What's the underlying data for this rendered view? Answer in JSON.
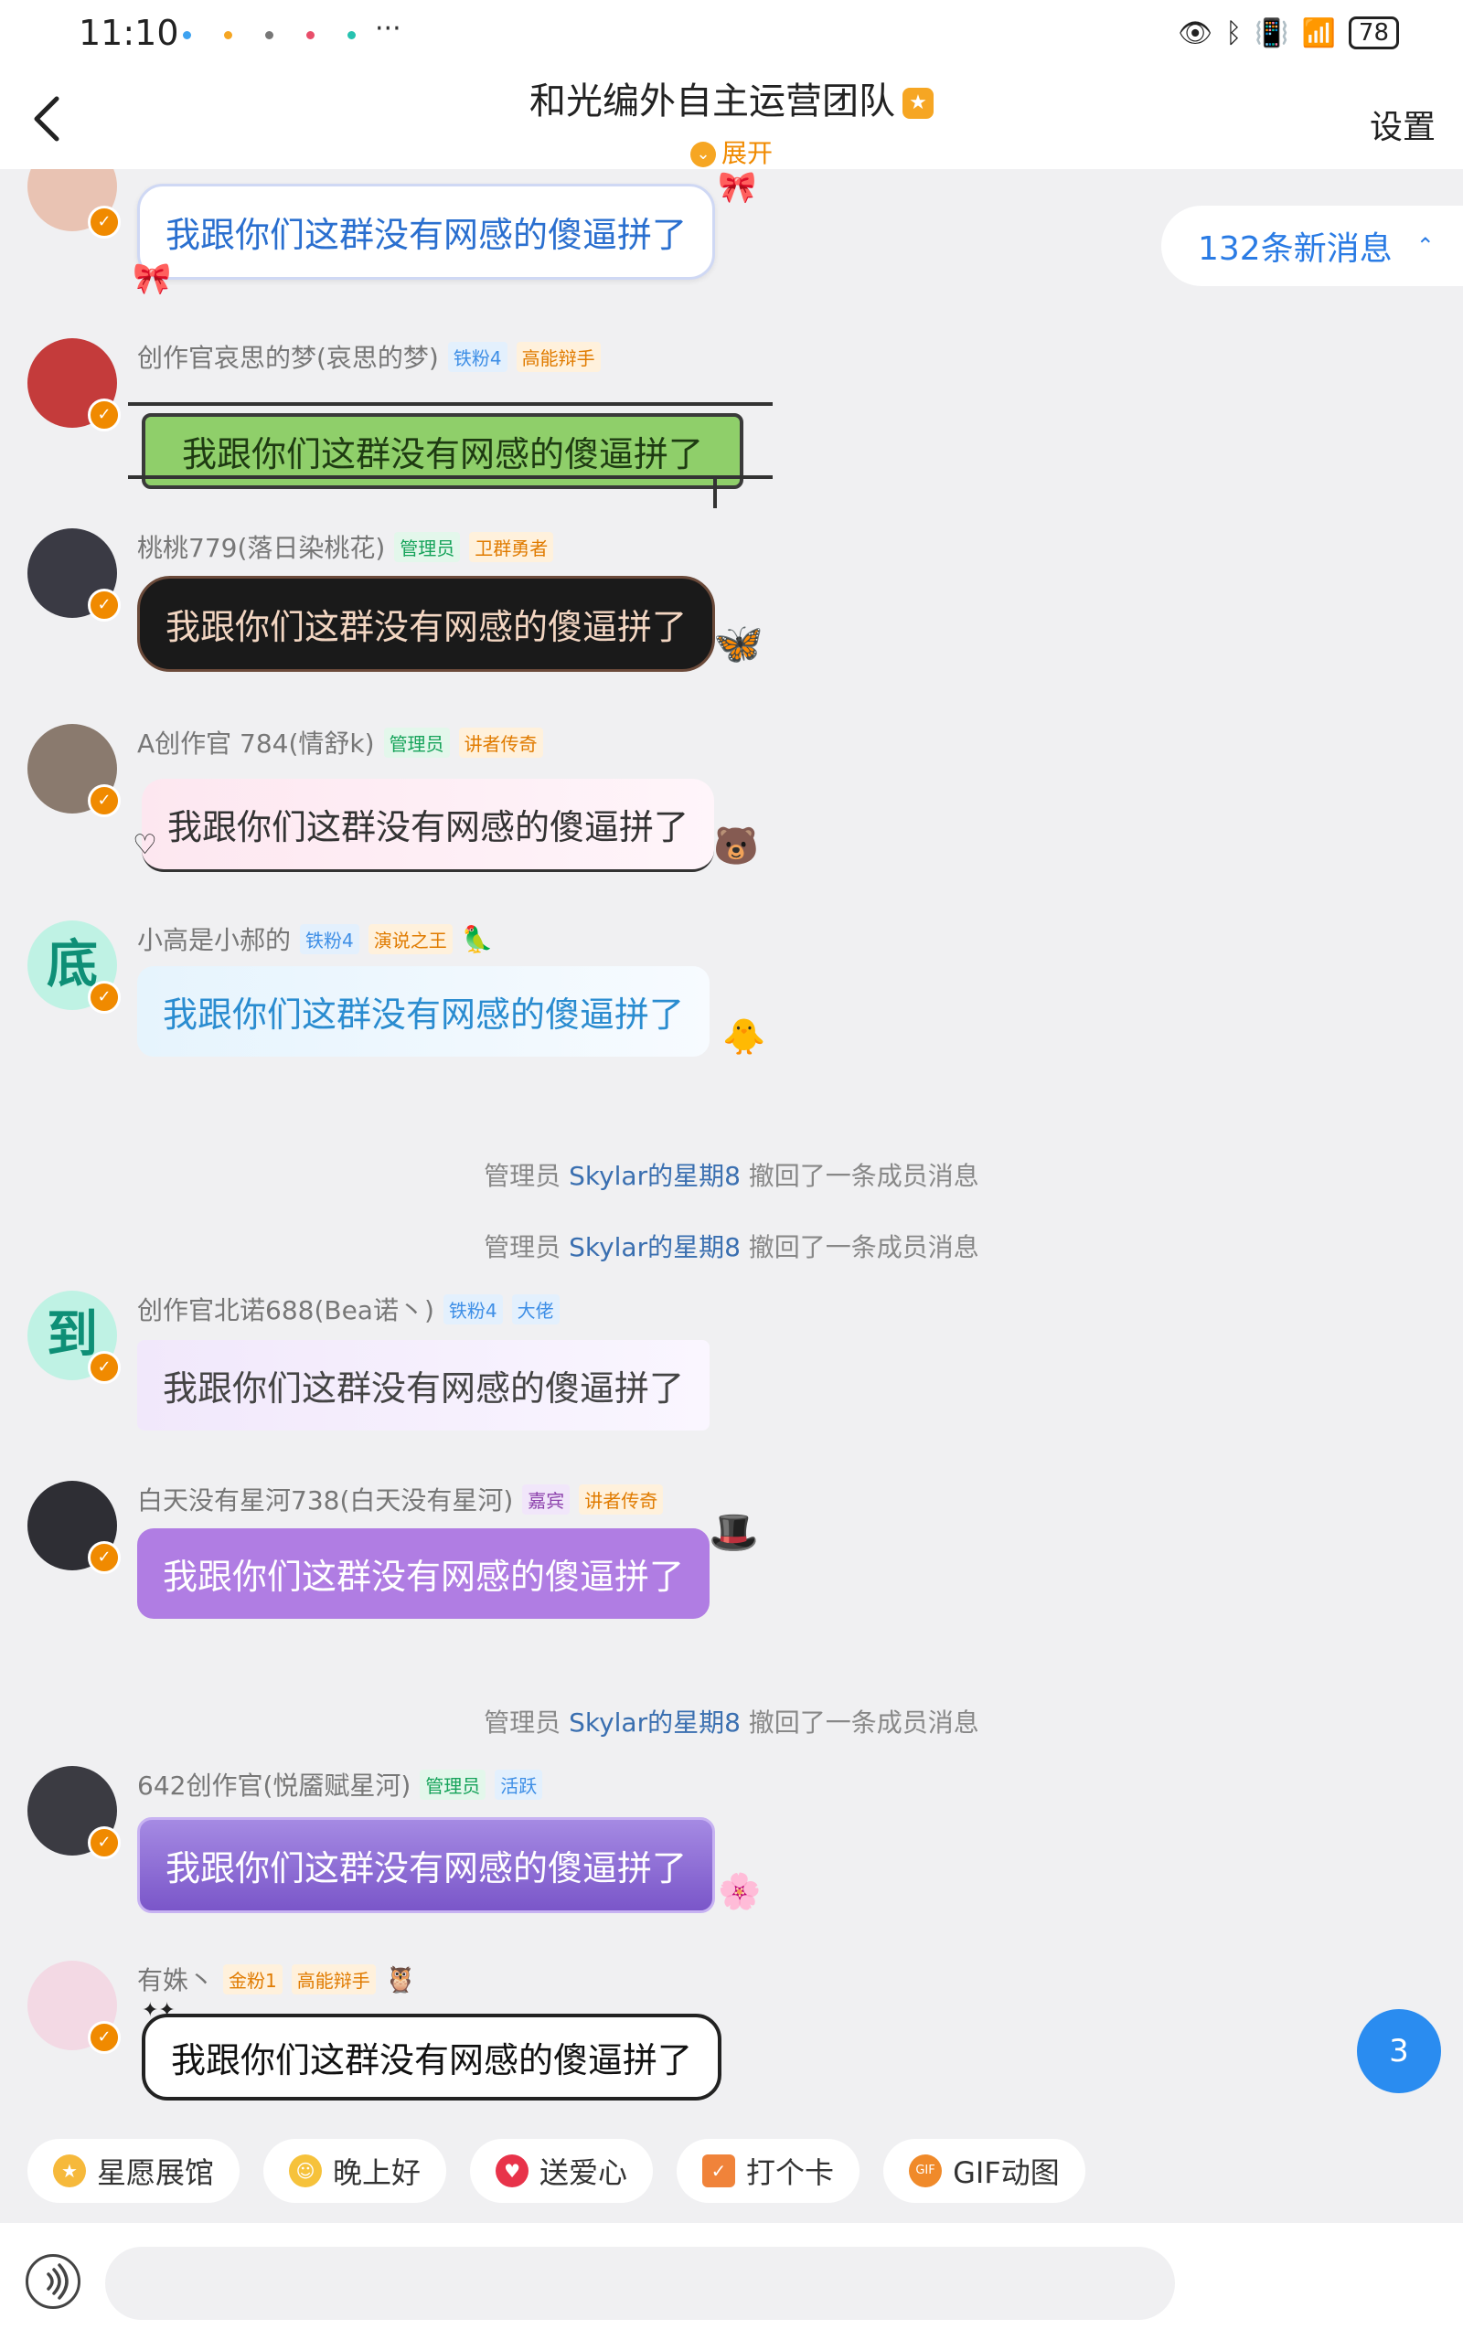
{
  "status_bar": {
    "time": "11:10",
    "more": "···",
    "battery": "78",
    "dot_colors": [
      "#3da2f0",
      "#f5a623",
      "#777777",
      "#e84e6a",
      "#27c2b0"
    ]
  },
  "header": {
    "title": "和光编外自主运营团队",
    "expand_label": "展开",
    "settings_label": "设置"
  },
  "new_messages_label": "132条新消息",
  "unread_count": "3",
  "messages": [
    {
      "name": "",
      "tags": [],
      "text": "我跟你们这群没有网感的傻逼拼了",
      "avatar_color": "#e9c3b3",
      "bubble_style": "white-pink"
    },
    {
      "name": "创作官哀思的梦(哀思的梦)",
      "tags": [
        {
          "label": "铁粉4",
          "style": "blue"
        },
        {
          "label": "高能辩手",
          "style": "orange"
        }
      ],
      "text": "我跟你们这群没有网感的傻逼拼了",
      "avatar_color": "#c43b3b",
      "bubble_style": "green-sign"
    },
    {
      "name": "桃桃779(落日染桃花)",
      "tags": [
        {
          "label": "管理员",
          "style": "green"
        },
        {
          "label": "卫群勇者",
          "style": "orange"
        }
      ],
      "text": "我跟你们这群没有网感的傻逼拼了",
      "avatar_color": "#3a3a44",
      "bubble_style": "dark"
    },
    {
      "name": "A创作官 784(情舒k)",
      "tags": [
        {
          "label": "管理员",
          "style": "green"
        },
        {
          "label": "讲者传奇",
          "style": "orange"
        }
      ],
      "text": "我跟你们这群没有网感的傻逼拼了",
      "avatar_color": "#8a7a6e",
      "bubble_style": "pink"
    },
    {
      "name": "小高是小郝的",
      "tags": [
        {
          "label": "铁粉4",
          "style": "blue"
        },
        {
          "label": "演说之王",
          "style": "orange"
        }
      ],
      "text": "我跟你们这群没有网感的傻逼拼了",
      "avatar_color": "#2ab59c",
      "avatar_char": "底",
      "bubble_style": "light-blue"
    },
    {
      "name": "创作官北诺688(Bea诺丶)",
      "tags": [
        {
          "label": "铁粉4",
          "style": "blue"
        },
        {
          "label": "大佬",
          "style": "blue"
        }
      ],
      "text": "我跟你们这群没有网感的傻逼拼了",
      "avatar_color": "#2ab59c",
      "avatar_char": "到",
      "bubble_style": "lavender"
    },
    {
      "name": "白天没有星河738(白天没有星河)",
      "tags": [
        {
          "label": "嘉宾",
          "style": "purple"
        },
        {
          "label": "讲者传奇",
          "style": "orange"
        }
      ],
      "text": "我跟你们这群没有网感的傻逼拼了",
      "avatar_color": "#2e2e34",
      "bubble_style": "purple"
    },
    {
      "name": "642创作官(悦靥赋星河)",
      "tags": [
        {
          "label": "管理员",
          "style": "green"
        },
        {
          "label": "活跃",
          "style": "blue"
        }
      ],
      "text": "我跟你们这群没有网感的傻逼拼了",
      "avatar_color": "#3b3b42",
      "bubble_style": "violet"
    },
    {
      "name": "有姝丶",
      "tags": [
        {
          "label": "金粉1",
          "style": "gold"
        },
        {
          "label": "高能辩手",
          "style": "orange"
        }
      ],
      "text": "我跟你们这群没有网感的傻逼拼了",
      "avatar_color": "#f3d9e4",
      "bubble_style": "white-black"
    }
  ],
  "system_notice": {
    "prefix": "管理员 ",
    "name": "Skylar的星期8",
    "suffix": " 撤回了一条成员消息"
  },
  "quick_actions": [
    {
      "label": "星愿展馆",
      "icon": "star-icon",
      "color": "#f6b93b"
    },
    {
      "label": "晚上好",
      "icon": "smile-star-icon",
      "color": "#f6c23b"
    },
    {
      "label": "送爱心",
      "icon": "heart-icon",
      "color": "#e8334a"
    },
    {
      "label": "打个卡",
      "icon": "checkin-icon",
      "color": "#f0833a"
    },
    {
      "label": "GIF动图",
      "icon": "gif-icon",
      "color": "#f08a2a"
    }
  ]
}
